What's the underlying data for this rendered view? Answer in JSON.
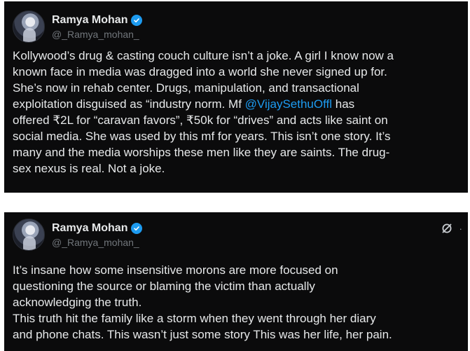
{
  "posts": [
    {
      "author": {
        "name": "Ramya Mohan",
        "handle": "@_Ramya_mohan_",
        "verified": true,
        "avatar_icon": "profile-photo"
      },
      "lines": [
        [
          "Kollywood’s drug & casting couch culture isn’t a joke. A girl I know now a"
        ],
        [
          "known face in media was dragged into a world she never signed up for."
        ],
        [
          "She’s now in  rehab center. Drugs, manipulation, and transactional"
        ],
        [
          "exploitation disguised as “industry norm. Mf ",
          "@VijaySethuOffl",
          " has"
        ],
        [
          "offered ₹2L for “caravan favors”, ₹50k for “drives” and acts like saint on"
        ],
        [
          "social media. She was used by this mf for years. This isn’t one story. It’s"
        ],
        [
          "many and the media worships these men like they are saints. The drug-"
        ],
        [
          "sex nexus is real. Not a joke."
        ]
      ]
    },
    {
      "author": {
        "name": "Ramya Mohan",
        "handle": "@_Ramya_mohan_",
        "verified": true,
        "avatar_icon": "profile-photo"
      },
      "top_right_icons": [
        "grok-icon",
        "more-icon"
      ],
      "more_label": "·",
      "lines": [
        [
          "It’s insane how some insensitive morons are more focused on"
        ],
        [
          "questioning the source or blaming the victim than actually"
        ],
        [
          "acknowledging the truth."
        ],
        [
          "This truth hit the family like a storm when they went through her diary"
        ],
        [
          "and phone chats. This wasn’t just some story This was her life, her pain."
        ]
      ]
    }
  ],
  "colors": {
    "card_background": "#0b0b0c",
    "text": "#e7e9ea",
    "handle": "#71767b",
    "mention": "#1d9bf0",
    "verified_badge": "#1d9bf0",
    "page_background": "#ffffff"
  }
}
